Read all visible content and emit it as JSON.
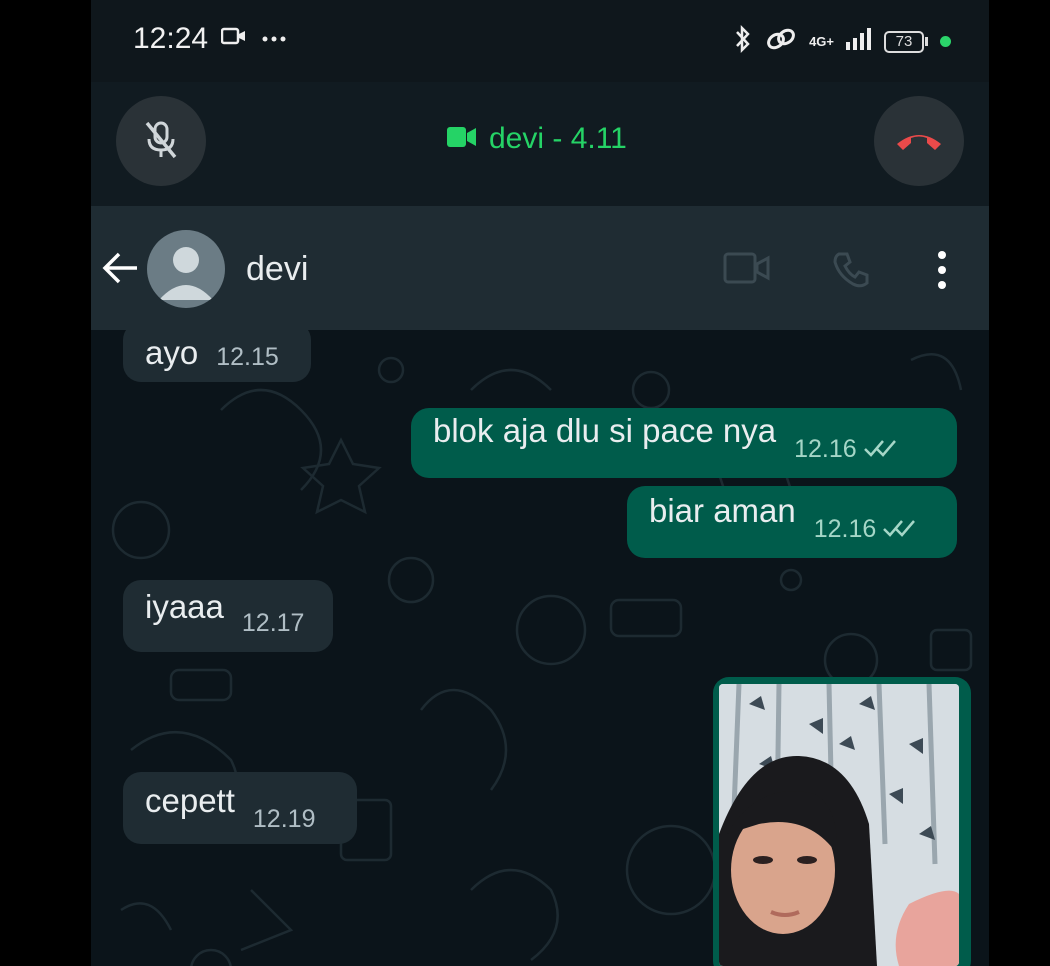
{
  "status_bar": {
    "time": "12:24",
    "network": "4G+",
    "battery": "73"
  },
  "call": {
    "title": "devi - 4.11"
  },
  "chat_header": {
    "contact_name": "devi"
  },
  "messages": [
    {
      "direction": "in",
      "text": "ayo",
      "time": "12.15"
    },
    {
      "direction": "out",
      "text": "blok aja dlu si pace nya",
      "time": "12.16",
      "status": "read"
    },
    {
      "direction": "out",
      "text": "biar aman",
      "time": "12.16",
      "status": "read"
    },
    {
      "direction": "in",
      "text": "iyaaa",
      "time": "12.17"
    },
    {
      "direction": "in",
      "text": "cepett",
      "time": "12.19"
    },
    {
      "direction": "out",
      "type": "image"
    }
  ],
  "colors": {
    "accent_green": "#25d366",
    "outgoing_bubble": "#005c4b",
    "incoming_bubble": "#1f2c33",
    "end_call_red": "#ea4a4a",
    "background": "#0b141a"
  }
}
